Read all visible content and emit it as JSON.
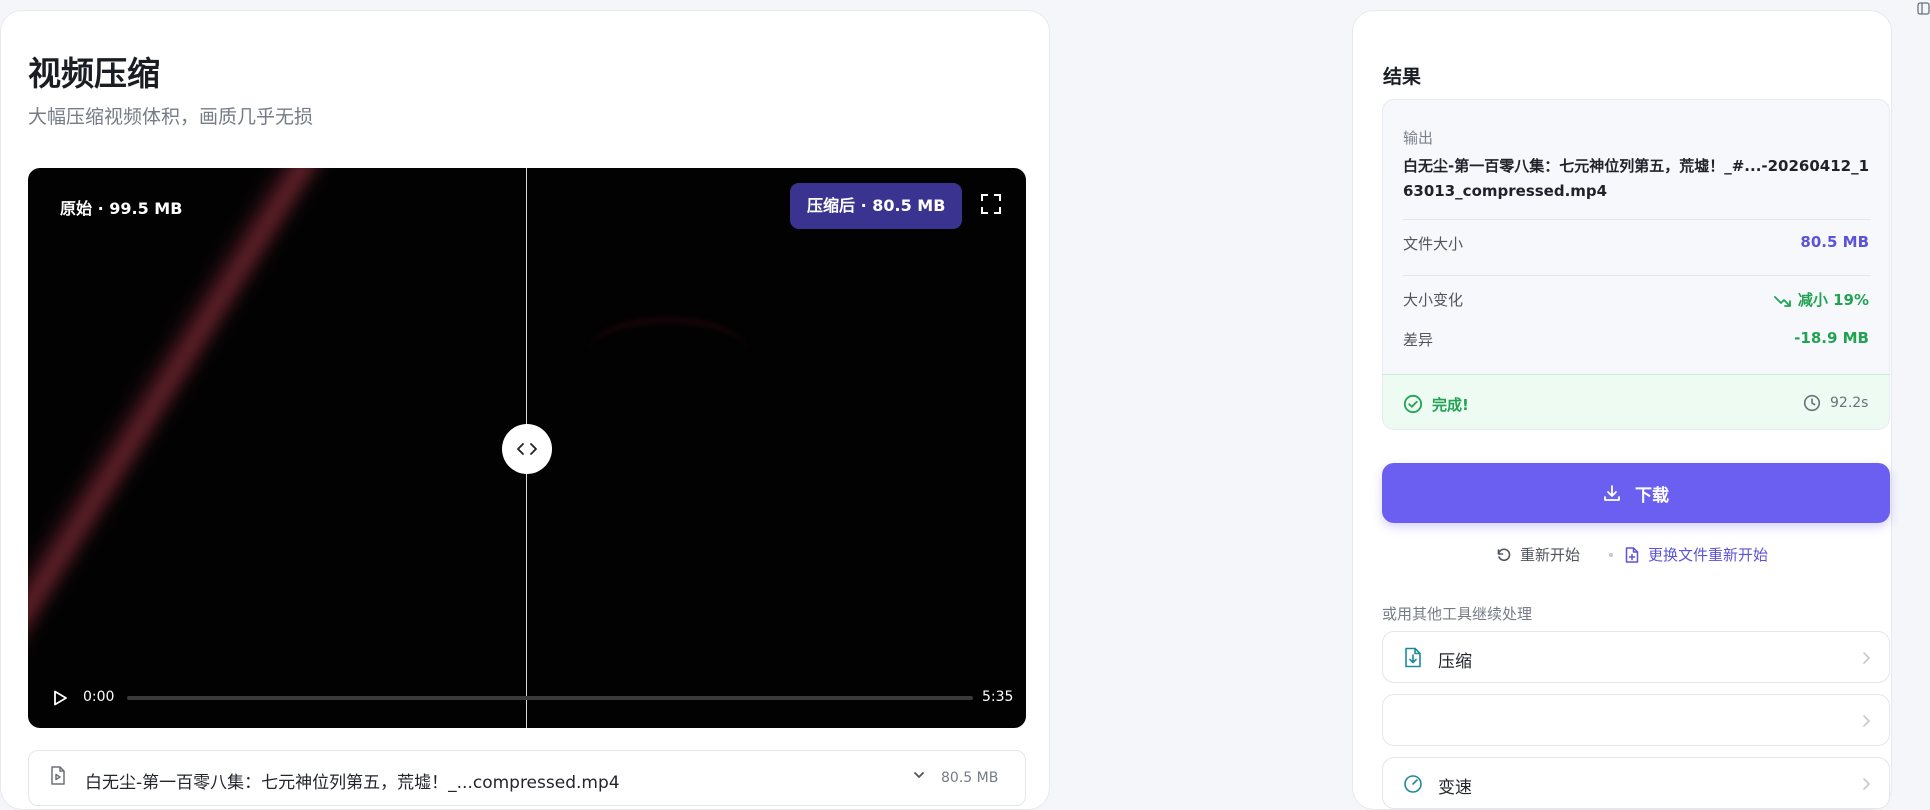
{
  "header": {
    "title": "视频压缩",
    "subtitle": "大幅压缩视频体积，画质几乎无损"
  },
  "player": {
    "original_label": "原始 · 99.5 MB",
    "compressed_label": "压缩后 · 80.5 MB",
    "current_time": "0:00",
    "total_time": "5:35",
    "progress": 0
  },
  "file": {
    "name": "白无尘-第一百零八集：七元神位列第五，荒墟！_...compressed.mp4",
    "size": "80.5 MB"
  },
  "result": {
    "title": "结果",
    "output_label": "输出",
    "output_name": "白无尘-第一百零八集：七元神位列第五，荒墟！_#...-20260412_163013_compressed.mp4",
    "file_size_label": "文件大小",
    "file_size_value": "80.5 MB",
    "size_change_label": "大小变化",
    "size_change_value": "减小 19%",
    "diff_label": "差异",
    "diff_value": "-18.9 MB",
    "status_text": "完成!",
    "duration": "92.2s"
  },
  "actions": {
    "download_label": "下载",
    "restart_label": "重新开始",
    "replace_label": "更换文件重新开始",
    "other_tools_label": "或用其他工具继续处理"
  },
  "tools": [
    {
      "label": "压缩",
      "icon": "file-compress-icon"
    },
    {
      "label": "",
      "icon": ""
    },
    {
      "label": "变速",
      "icon": "speedometer-icon"
    }
  ],
  "colors": {
    "accent": "#6a5ff0",
    "badge": "#3a3490",
    "success": "#22a354",
    "teal_icon": "#1b8a99"
  }
}
